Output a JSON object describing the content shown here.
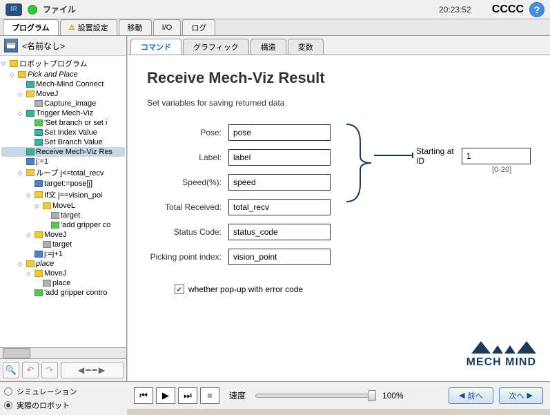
{
  "header": {
    "file_menu": "ファイル",
    "clock": "20:23:52",
    "status_text": "CCCC"
  },
  "main_tabs": [
    {
      "label": "プログラム",
      "active": true
    },
    {
      "label": "設置設定",
      "warn": true
    },
    {
      "label": "移動"
    },
    {
      "label": "I/O"
    },
    {
      "label": "ログ"
    }
  ],
  "sidebar": {
    "title": "<名前なし>"
  },
  "tree": [
    {
      "indent": 0,
      "label": "ロボットプログラム",
      "toggle": "▽",
      "icon": "yellow"
    },
    {
      "indent": 1,
      "label": "Pick and Place",
      "toggle": "◇",
      "icon": "yellow",
      "italic": true
    },
    {
      "indent": 2,
      "label": "Mech-Mind Connect",
      "toggle": "",
      "icon": "teal"
    },
    {
      "indent": 2,
      "label": "MoveJ",
      "toggle": "◇",
      "icon": "yellow"
    },
    {
      "indent": 3,
      "label": "Capture_image",
      "toggle": "",
      "icon": "gray"
    },
    {
      "indent": 2,
      "label": "Trigger Mech-Viz",
      "toggle": "◇",
      "icon": "teal"
    },
    {
      "indent": 3,
      "label": "'Set branch or set i",
      "toggle": "",
      "icon": "green"
    },
    {
      "indent": 3,
      "label": "Set Index Value",
      "toggle": "",
      "icon": "teal"
    },
    {
      "indent": 3,
      "label": "Set Branch Value",
      "toggle": "",
      "icon": "teal"
    },
    {
      "indent": 2,
      "label": "Receive Mech-Viz Res",
      "toggle": "",
      "icon": "teal",
      "selected": true
    },
    {
      "indent": 2,
      "label": "j:=1",
      "toggle": "",
      "icon": "blue"
    },
    {
      "indent": 2,
      "label": "ループ j<=total_recv",
      "toggle": "◇",
      "icon": "yellow"
    },
    {
      "indent": 3,
      "label": "target:=pose[j]",
      "toggle": "",
      "icon": "blue"
    },
    {
      "indent": 3,
      "label": "If文 j==vision_poi",
      "toggle": "◇",
      "icon": "yellow"
    },
    {
      "indent": 4,
      "label": "MoveL",
      "toggle": "◇",
      "icon": "yellow"
    },
    {
      "indent": 5,
      "label": "target",
      "toggle": "",
      "icon": "gray"
    },
    {
      "indent": 5,
      "label": "'add gripper co",
      "toggle": "",
      "icon": "green"
    },
    {
      "indent": 3,
      "label": "MoveJ",
      "toggle": "◇",
      "icon": "yellow"
    },
    {
      "indent": 4,
      "label": "target",
      "toggle": "",
      "icon": "gray"
    },
    {
      "indent": 3,
      "label": "j:=j+1",
      "toggle": "",
      "icon": "blue"
    },
    {
      "indent": 2,
      "label": "place",
      "toggle": "◇",
      "icon": "yellow",
      "italic": true
    },
    {
      "indent": 3,
      "label": "MoveJ",
      "toggle": "◇",
      "icon": "yellow"
    },
    {
      "indent": 4,
      "label": "place",
      "toggle": "",
      "icon": "gray"
    },
    {
      "indent": 3,
      "label": "'add gripper contro",
      "toggle": "",
      "icon": "green"
    }
  ],
  "sub_tabs": [
    {
      "label": "コマンド",
      "active": true
    },
    {
      "label": "グラフィック"
    },
    {
      "label": "構造"
    },
    {
      "label": "変数"
    }
  ],
  "form": {
    "title": "Receive Mech-Viz Result",
    "subtitle": "Set variables for saving returned data",
    "pose_label": "Pose:",
    "pose_value": "pose",
    "label_label": "Label:",
    "label_value": "label",
    "speed_label": "Speed(%):",
    "speed_value": "speed",
    "total_label": "Total Received:",
    "total_value": "total_recv",
    "status_label": "Status Code:",
    "status_value": "status_code",
    "picking_label": "Picking point index:",
    "picking_value": "vision_point",
    "starting_label": "Starting at ID",
    "starting_value": "1",
    "starting_range": "[0-20]",
    "checkbox_label": "whether pop-up with error code",
    "checkbox_checked": true
  },
  "footer": {
    "speed_label": "速度",
    "speed_value": "100%",
    "prev": "前へ",
    "next": "次へ"
  },
  "sim": {
    "simulation": "シミュレーション",
    "real": "実際のロボット"
  },
  "logo": {
    "text": "MECH MIND"
  }
}
